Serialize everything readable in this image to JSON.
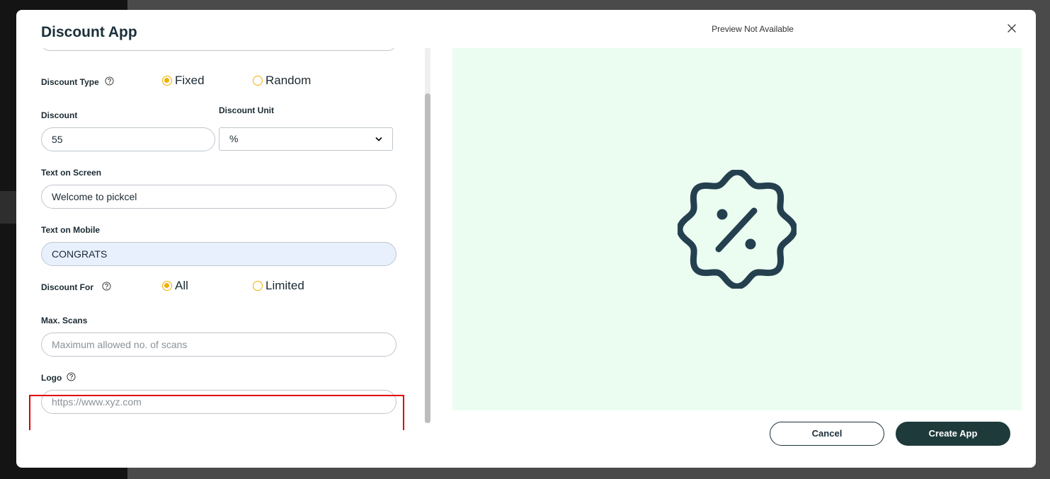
{
  "modal": {
    "title": "Discount App",
    "preview_title": "Preview Not Available"
  },
  "form": {
    "discount_type": {
      "label": "Discount Type",
      "options": [
        "Fixed",
        "Random"
      ],
      "selected": "Fixed"
    },
    "discount": {
      "label": "Discount",
      "value": "55"
    },
    "discount_unit": {
      "label": "Discount Unit",
      "value": "%"
    },
    "text_on_screen": {
      "label": "Text on Screen",
      "value": "Welcome to pickcel"
    },
    "text_on_mobile": {
      "label": "Text on Mobile",
      "value": "CONGRATS"
    },
    "discount_for": {
      "label": "Discount For",
      "options": [
        "All",
        "Limited"
      ],
      "selected": "All"
    },
    "max_scans": {
      "label": "Max. Scans",
      "placeholder": "Maximum allowed no. of scans"
    },
    "logo": {
      "label": "Logo",
      "placeholder": "https://www.xyz.com"
    }
  },
  "footer": {
    "cancel_label": "Cancel",
    "create_label": "Create App"
  },
  "icons": {
    "help": "help-circle-icon",
    "close": "close-icon",
    "preview": "discount-badge-icon",
    "chevron": "chevron-down-icon"
  },
  "colors": {
    "accent": "#f0b000",
    "primary": "#1e3a3a",
    "preview_bg": "#ebfdf0",
    "highlight": "#e00000"
  }
}
